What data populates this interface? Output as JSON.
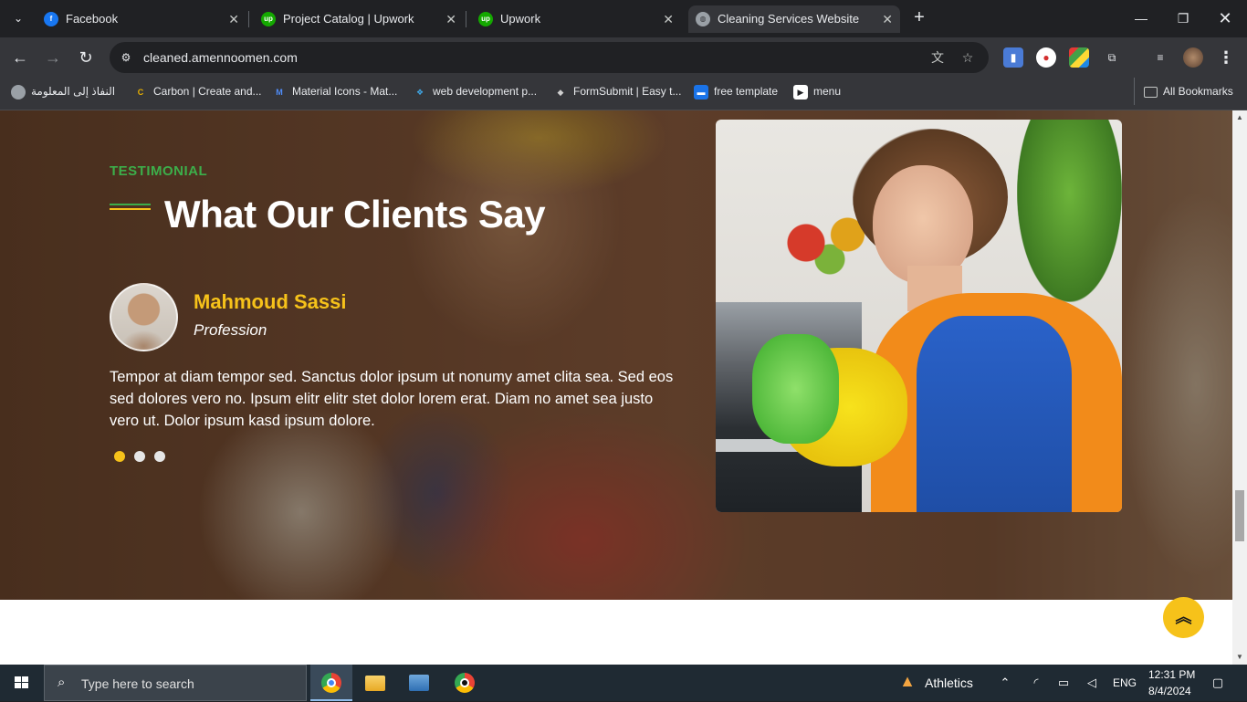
{
  "browser": {
    "tabs": [
      {
        "label": "Facebook",
        "icon": "facebook-icon"
      },
      {
        "label": "Project Catalog | Upwork",
        "icon": "upwork-icon"
      },
      {
        "label": "Upwork",
        "icon": "upwork-icon"
      },
      {
        "label": "Cleaning Services Website",
        "icon": "globe-icon",
        "active": true
      }
    ],
    "url": "cleaned.amennoomen.com",
    "bookmarks": [
      {
        "label": "النفاذ إلى المعلومة",
        "icon": "globe-icon"
      },
      {
        "label": "Carbon | Create and...",
        "icon": "carbon-icon"
      },
      {
        "label": "Material Icons - Mat...",
        "icon": "material-icon"
      },
      {
        "label": "web development p...",
        "icon": "webdev-icon"
      },
      {
        "label": "FormSubmit | Easy t...",
        "icon": "formsubmit-icon"
      },
      {
        "label": "free template",
        "icon": "template-icon"
      },
      {
        "label": "menu",
        "icon": "menu-icon"
      }
    ],
    "all_bookmarks": "All Bookmarks"
  },
  "testimonial": {
    "eyebrow": "TESTIMONIAL",
    "title": "What Our Clients Say",
    "client_name": "Mahmoud Sassi",
    "client_profession": "Profession",
    "quote": "Tempor at diam tempor sed. Sanctus dolor ipsum ut nonumy amet clita sea. Sed eos sed dolores vero no. Ipsum elitr elitr stet dolor lorem erat. Diam no amet sea justo vero ut. Dolor ipsum kasd ipsum dolore.",
    "slides": 3,
    "active_slide": 1
  },
  "colors": {
    "accent_yellow": "#f6c21a",
    "accent_green": "#3cae4a"
  },
  "taskbar": {
    "search_placeholder": "Type here to search",
    "weather": "Athletics",
    "language": "ENG",
    "time": "12:31 PM",
    "date": "8/4/2024"
  }
}
